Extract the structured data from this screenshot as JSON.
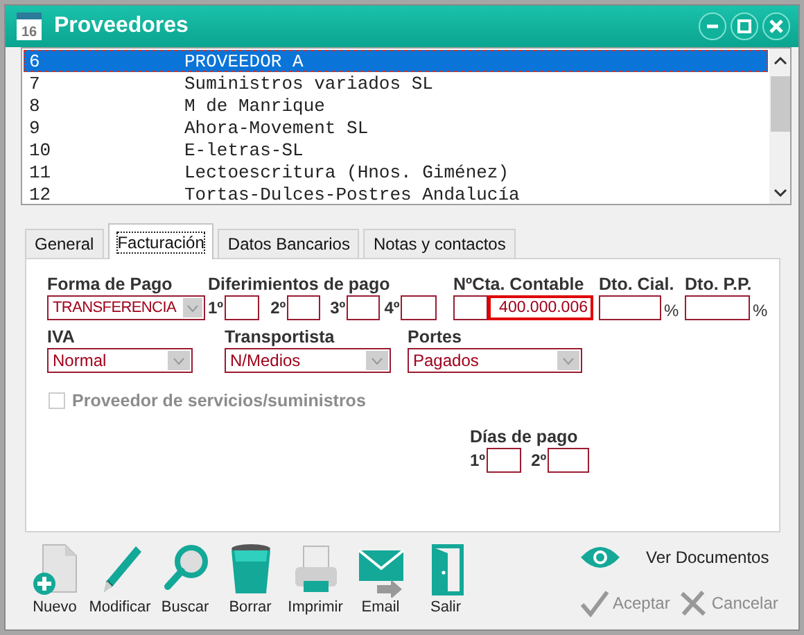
{
  "window": {
    "title": "Proveedores",
    "app_badge": "16"
  },
  "suppliers": [
    {
      "code": "6",
      "name": "PROVEEDOR A",
      "selected": true
    },
    {
      "code": "7",
      "name": "Suministros variados SL",
      "selected": false
    },
    {
      "code": "8",
      "name": "M de Manrique",
      "selected": false
    },
    {
      "code": "9",
      "name": "Ahora-Movement SL",
      "selected": false
    },
    {
      "code": "10",
      "name": "E-letras-SL",
      "selected": false
    },
    {
      "code": "11",
      "name": "Lectoescritura (Hnos. Giménez)",
      "selected": false
    },
    {
      "code": "12",
      "name": "Tortas-Dulces-Postres Andalucía",
      "selected": false
    }
  ],
  "tabs": [
    {
      "label": "General",
      "selected": false
    },
    {
      "label": "Facturación",
      "selected": true
    },
    {
      "label": "Datos Bancarios",
      "selected": false
    },
    {
      "label": "Notas y contactos",
      "selected": false
    }
  ],
  "form": {
    "forma_de_pago": {
      "label": "Forma de Pago",
      "value": "TRANSFERENCIA"
    },
    "diferimientos": {
      "label": "Diferimientos de pago",
      "slots": [
        {
          "label": "1º"
        },
        {
          "label": "2º"
        },
        {
          "label": "3º"
        },
        {
          "label": "4º"
        }
      ]
    },
    "cuenta": {
      "label": "NºCta. Contable",
      "value": "400.000.006"
    },
    "dto_cial": {
      "label": "Dto. Cial.",
      "unit": "%"
    },
    "dto_pp": {
      "label": "Dto. P.P.",
      "unit": "%"
    },
    "iva": {
      "label": "IVA",
      "value": "Normal"
    },
    "transportista": {
      "label": "Transportista",
      "value": "N/Medios"
    },
    "portes": {
      "label": "Portes",
      "value": "Pagados"
    },
    "servicios": {
      "label": "Proveedor de servicios/suministros",
      "checked": false,
      "disabled": true
    },
    "dias_de_pago": {
      "label": "Días de pago",
      "slots": [
        {
          "label": "1º"
        },
        {
          "label": "2º"
        }
      ]
    }
  },
  "toolbar": [
    {
      "label": "Nuevo",
      "kind": "new"
    },
    {
      "label": "Modificar",
      "kind": "edit"
    },
    {
      "label": "Buscar",
      "kind": "search"
    },
    {
      "label": "Borrar",
      "kind": "delete"
    },
    {
      "label": "Imprimir",
      "kind": "print"
    },
    {
      "label": "Email",
      "kind": "email"
    },
    {
      "label": "Salir",
      "kind": "exit"
    }
  ],
  "documents": {
    "label": "Ver Documentos"
  },
  "actions": [
    {
      "label": "Aceptar",
      "kind": "accept",
      "disabled": true
    },
    {
      "label": "Cancelar",
      "kind": "cancel",
      "disabled": true
    }
  ]
}
